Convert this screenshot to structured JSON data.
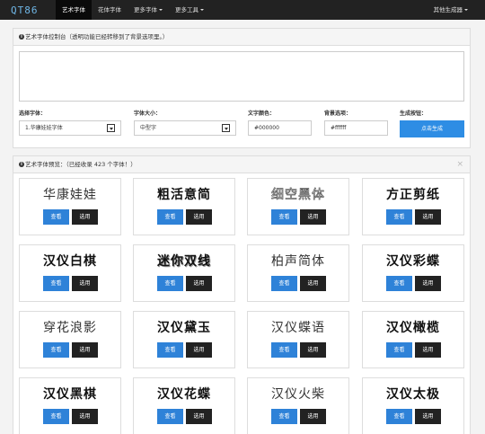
{
  "nav": {
    "logo": "QT86",
    "items": [
      {
        "label": "艺术字体",
        "active": true,
        "caret": false
      },
      {
        "label": "花体字体",
        "active": false,
        "caret": false
      },
      {
        "label": "更多字体",
        "active": false,
        "caret": true
      },
      {
        "label": "更多工具",
        "active": false,
        "caret": true
      }
    ],
    "right": "其他生成器"
  },
  "control_panel": {
    "title": "艺术字体控制台（透明功能已经转移到了背景选项里。）",
    "preview_text": "",
    "font_label": "选择字体：",
    "font_value": "1.华康娃娃字体",
    "size_label": "字体大小：",
    "size_value": "中型字",
    "color_label": "文字颜色：",
    "color_value": "#000000",
    "bg_label": "背景选项：",
    "bg_value": "#ffffff",
    "generate_label": "生成按钮：",
    "generate_button": "点击生成"
  },
  "fonts_panel": {
    "title": "艺术字体预览：（已经收录 423 个字体！）",
    "close": "×",
    "view_label": "查看",
    "use_label": "选用",
    "fonts": [
      {
        "name": "华康娃娃",
        "style": "s-light"
      },
      {
        "name": "粗活意简",
        "style": "s-heavy"
      },
      {
        "name": "细空黑体",
        "style": "s-outline"
      },
      {
        "name": "方正剪纸",
        "style": "s-heavy"
      },
      {
        "name": "汉仪白棋",
        "style": "s-heavy"
      },
      {
        "name": "迷你双线",
        "style": "s-shadow"
      },
      {
        "name": "柏声简体",
        "style": "s-light"
      },
      {
        "name": "汉仪彩蝶",
        "style": "s-serif"
      },
      {
        "name": "穿花浪影",
        "style": "s-light"
      },
      {
        "name": "汉仪黛玉",
        "style": "s-serif"
      },
      {
        "name": "汉仪蝶语",
        "style": "s-light"
      },
      {
        "name": "汉仪橄榄",
        "style": "s-heavy"
      },
      {
        "name": "汉仪黑棋",
        "style": "s-heavy"
      },
      {
        "name": "汉仪花蝶",
        "style": "s-serif"
      },
      {
        "name": "汉仪火柴",
        "style": "s-light"
      },
      {
        "name": "汉仪太极",
        "style": "s-heavy"
      }
    ]
  }
}
